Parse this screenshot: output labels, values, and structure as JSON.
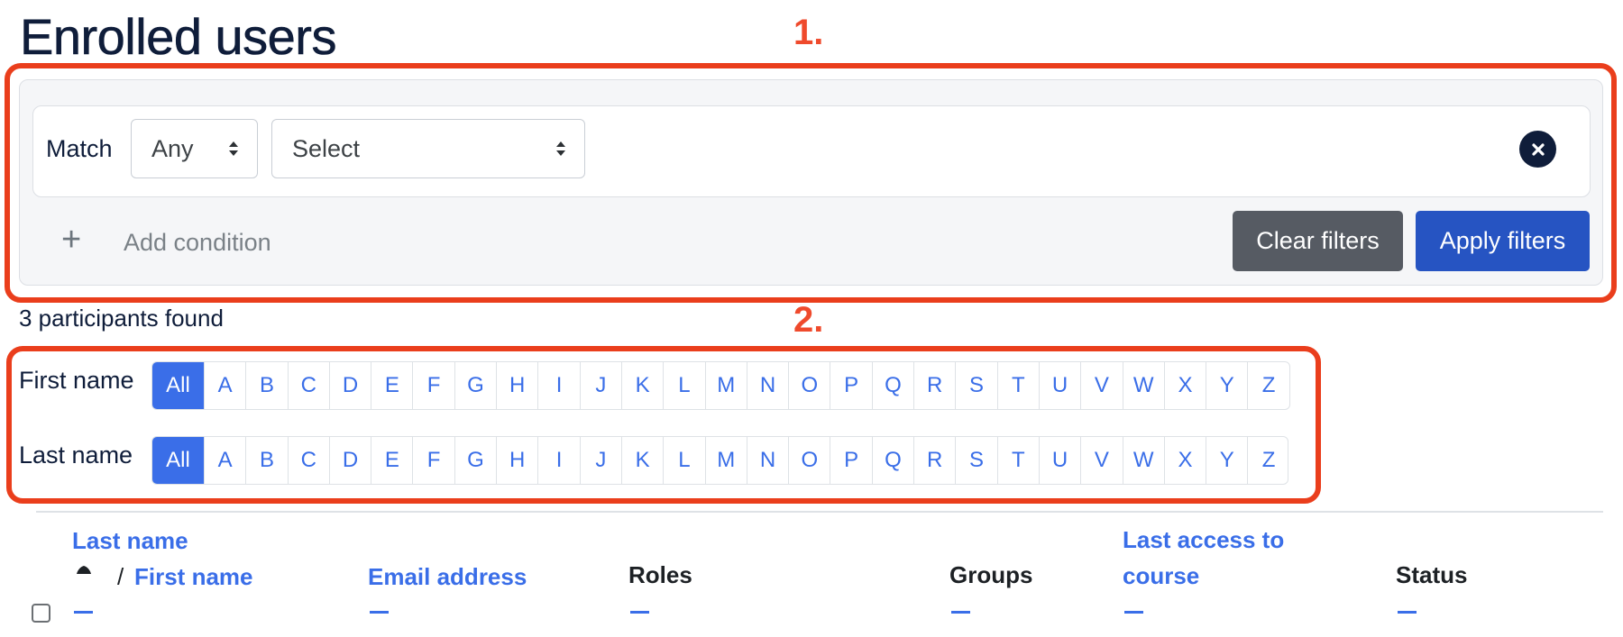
{
  "page": {
    "title": "Enrolled users"
  },
  "annotations": {
    "one": "1.",
    "two": "2."
  },
  "filter": {
    "match_label": "Match",
    "match_value": "Any",
    "condition_value": "Select",
    "add_condition_label": "Add condition",
    "clear_label": "Clear filters",
    "apply_label": "Apply filters",
    "icons": {
      "close": "close-circle-icon",
      "add": "plus-icon",
      "caret": "sort-caret-icon"
    }
  },
  "results": {
    "count_text": "3 participants found"
  },
  "initials": {
    "first_label": "First name",
    "last_label": "Last name",
    "all_label": "All",
    "letters": [
      "A",
      "B",
      "C",
      "D",
      "E",
      "F",
      "G",
      "H",
      "I",
      "J",
      "K",
      "L",
      "M",
      "N",
      "O",
      "P",
      "Q",
      "R",
      "S",
      "T",
      "U",
      "V",
      "W",
      "X",
      "Y",
      "Z"
    ],
    "first_selected": "All",
    "last_selected": "All"
  },
  "table": {
    "headers": {
      "last_name": "Last name",
      "separator": "/",
      "first_name": "First name",
      "email": "Email address",
      "roles": "Roles",
      "groups": "Groups",
      "last_access_line1": "Last access to",
      "last_access_line2": "course",
      "status": "Status"
    },
    "sort_icon": "sort-asc-icon"
  },
  "colors": {
    "accent": "#3a6ee8",
    "primary_button": "#2654c2",
    "secondary_button": "#565b63",
    "annotation": "#ea3e1c",
    "title": "#0f1d3a"
  }
}
